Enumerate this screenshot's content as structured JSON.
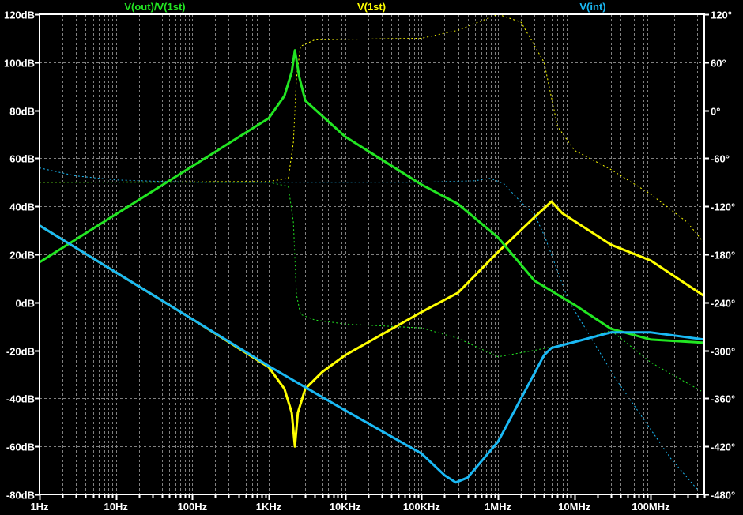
{
  "chart_data": {
    "type": "line",
    "title": "",
    "xscale": "log",
    "xlim": [
      1,
      500000000
    ],
    "ylim_left": [
      -80,
      120
    ],
    "ylim_right": [
      -480,
      120
    ],
    "grid": true,
    "legend_placement": "top",
    "background": "#000000",
    "x_ticks": [
      {
        "value": 1,
        "label": "1Hz"
      },
      {
        "value": 10,
        "label": "10Hz"
      },
      {
        "value": 100,
        "label": "100Hz"
      },
      {
        "value": 1000,
        "label": "1KHz"
      },
      {
        "value": 10000,
        "label": "10KHz"
      },
      {
        "value": 100000,
        "label": "100KHz"
      },
      {
        "value": 1000000,
        "label": "1MHz"
      },
      {
        "value": 10000000,
        "label": "10MHz"
      },
      {
        "value": 100000000,
        "label": "100MHz"
      }
    ],
    "y_ticks_left": [
      {
        "value": 120,
        "label": "120dB"
      },
      {
        "value": 100,
        "label": "100dB"
      },
      {
        "value": 80,
        "label": "80dB"
      },
      {
        "value": 60,
        "label": "60dB"
      },
      {
        "value": 40,
        "label": "40dB"
      },
      {
        "value": 20,
        "label": "20dB"
      },
      {
        "value": 0,
        "label": "0dB"
      },
      {
        "value": -20,
        "label": "-20dB"
      },
      {
        "value": -40,
        "label": "-40dB"
      },
      {
        "value": -60,
        "label": "-60dB"
      },
      {
        "value": -80,
        "label": "-80dB"
      }
    ],
    "y_ticks_right": [
      {
        "value": 120,
        "label": "120°"
      },
      {
        "value": 60,
        "label": "60°"
      },
      {
        "value": 0,
        "label": "0°"
      },
      {
        "value": -60,
        "label": "-60°"
      },
      {
        "value": -120,
        "label": "-120°"
      },
      {
        "value": -180,
        "label": "-180°"
      },
      {
        "value": -240,
        "label": "-240°"
      },
      {
        "value": -300,
        "label": "-300°"
      },
      {
        "value": -360,
        "label": "-360°"
      },
      {
        "value": -420,
        "label": "-420°"
      },
      {
        "value": -480,
        "label": "-480°"
      }
    ],
    "series": [
      {
        "name": "V(1st)",
        "color": "#ffff00",
        "magnitude_db": [
          [
            1,
            32
          ],
          [
            10,
            12.5
          ],
          [
            100,
            -7
          ],
          [
            1000,
            -27
          ],
          [
            1600,
            -36
          ],
          [
            2000,
            -46
          ],
          [
            2200,
            -60
          ],
          [
            2400,
            -46
          ],
          [
            3000,
            -36
          ],
          [
            5000,
            -29
          ],
          [
            10000,
            -22
          ],
          [
            100000,
            -4
          ],
          [
            300000,
            4
          ],
          [
            1000000,
            21
          ],
          [
            3000000,
            35.5
          ],
          [
            5000000,
            42
          ],
          [
            7000000,
            37
          ],
          [
            30000000,
            24
          ],
          [
            100000000,
            17.4
          ],
          [
            500000000,
            2.6
          ]
        ],
        "phase_deg": [
          [
            1,
            -90
          ],
          [
            1000,
            -89
          ],
          [
            1800,
            -85
          ],
          [
            2100,
            -40
          ],
          [
            2300,
            40
          ],
          [
            2600,
            80
          ],
          [
            4000,
            88
          ],
          [
            100000,
            90
          ],
          [
            300000,
            100
          ],
          [
            1000000,
            120
          ],
          [
            2000000,
            110
          ],
          [
            4000000,
            60
          ],
          [
            6000000,
            -20
          ],
          [
            10000000,
            -50
          ],
          [
            30000000,
            -74
          ],
          [
            100000000,
            -105
          ],
          [
            300000000,
            -140
          ],
          [
            500000000,
            -166
          ]
        ]
      },
      {
        "name": "V(out)/V(1st)",
        "color": "#22e622",
        "magnitude_db": [
          [
            1,
            16.7
          ],
          [
            10,
            36.7
          ],
          [
            100,
            56.7
          ],
          [
            1000,
            76.7
          ],
          [
            1600,
            86
          ],
          [
            2000,
            96
          ],
          [
            2200,
            105
          ],
          [
            2500,
            94
          ],
          [
            3000,
            84
          ],
          [
            10000,
            69
          ],
          [
            100000,
            49
          ],
          [
            300000,
            41
          ],
          [
            1000000,
            27
          ],
          [
            3000000,
            9
          ],
          [
            10000000,
            -1
          ],
          [
            30000000,
            -11
          ],
          [
            100000000,
            -15.5
          ],
          [
            500000000,
            -16.8
          ]
        ],
        "phase_deg": [
          [
            1,
            -90
          ],
          [
            1000,
            -90
          ],
          [
            1800,
            -95
          ],
          [
            2100,
            -140
          ],
          [
            2300,
            -230
          ],
          [
            2600,
            -255
          ],
          [
            4000,
            -262
          ],
          [
            10000,
            -267
          ],
          [
            100000,
            -272
          ],
          [
            300000,
            -285
          ],
          [
            1000000,
            -308
          ],
          [
            3000000,
            -300
          ],
          [
            10000000,
            -290
          ],
          [
            30000000,
            -275
          ],
          [
            100000000,
            -315
          ],
          [
            500000000,
            -353
          ]
        ]
      },
      {
        "name": "V(int)",
        "color": "#1ab9f5",
        "magnitude_db": [
          [
            1,
            32
          ],
          [
            10,
            12.5
          ],
          [
            100,
            -7
          ],
          [
            1000,
            -26.5
          ],
          [
            10000,
            -45
          ],
          [
            100000,
            -63
          ],
          [
            200000,
            -72
          ],
          [
            280000,
            -75
          ],
          [
            400000,
            -73
          ],
          [
            1000000,
            -58
          ],
          [
            2000000,
            -40
          ],
          [
            4000000,
            -22
          ],
          [
            5000000,
            -19
          ],
          [
            10000000,
            -16.5
          ],
          [
            30000000,
            -12.5
          ],
          [
            100000000,
            -12.5
          ],
          [
            500000000,
            -15.5
          ]
        ],
        "phase_deg": [
          [
            1,
            -72
          ],
          [
            3,
            -82
          ],
          [
            10,
            -87
          ],
          [
            100,
            -90
          ],
          [
            100000,
            -90
          ],
          [
            500000,
            -88
          ],
          [
            800000,
            -85
          ],
          [
            1200000,
            -92
          ],
          [
            2000000,
            -115
          ],
          [
            3000000,
            -130
          ],
          [
            4100000,
            -158
          ],
          [
            8300000,
            -237
          ],
          [
            35000000,
            -336
          ],
          [
            182000000,
            -435
          ],
          [
            425000000,
            -476
          ]
        ]
      }
    ]
  }
}
